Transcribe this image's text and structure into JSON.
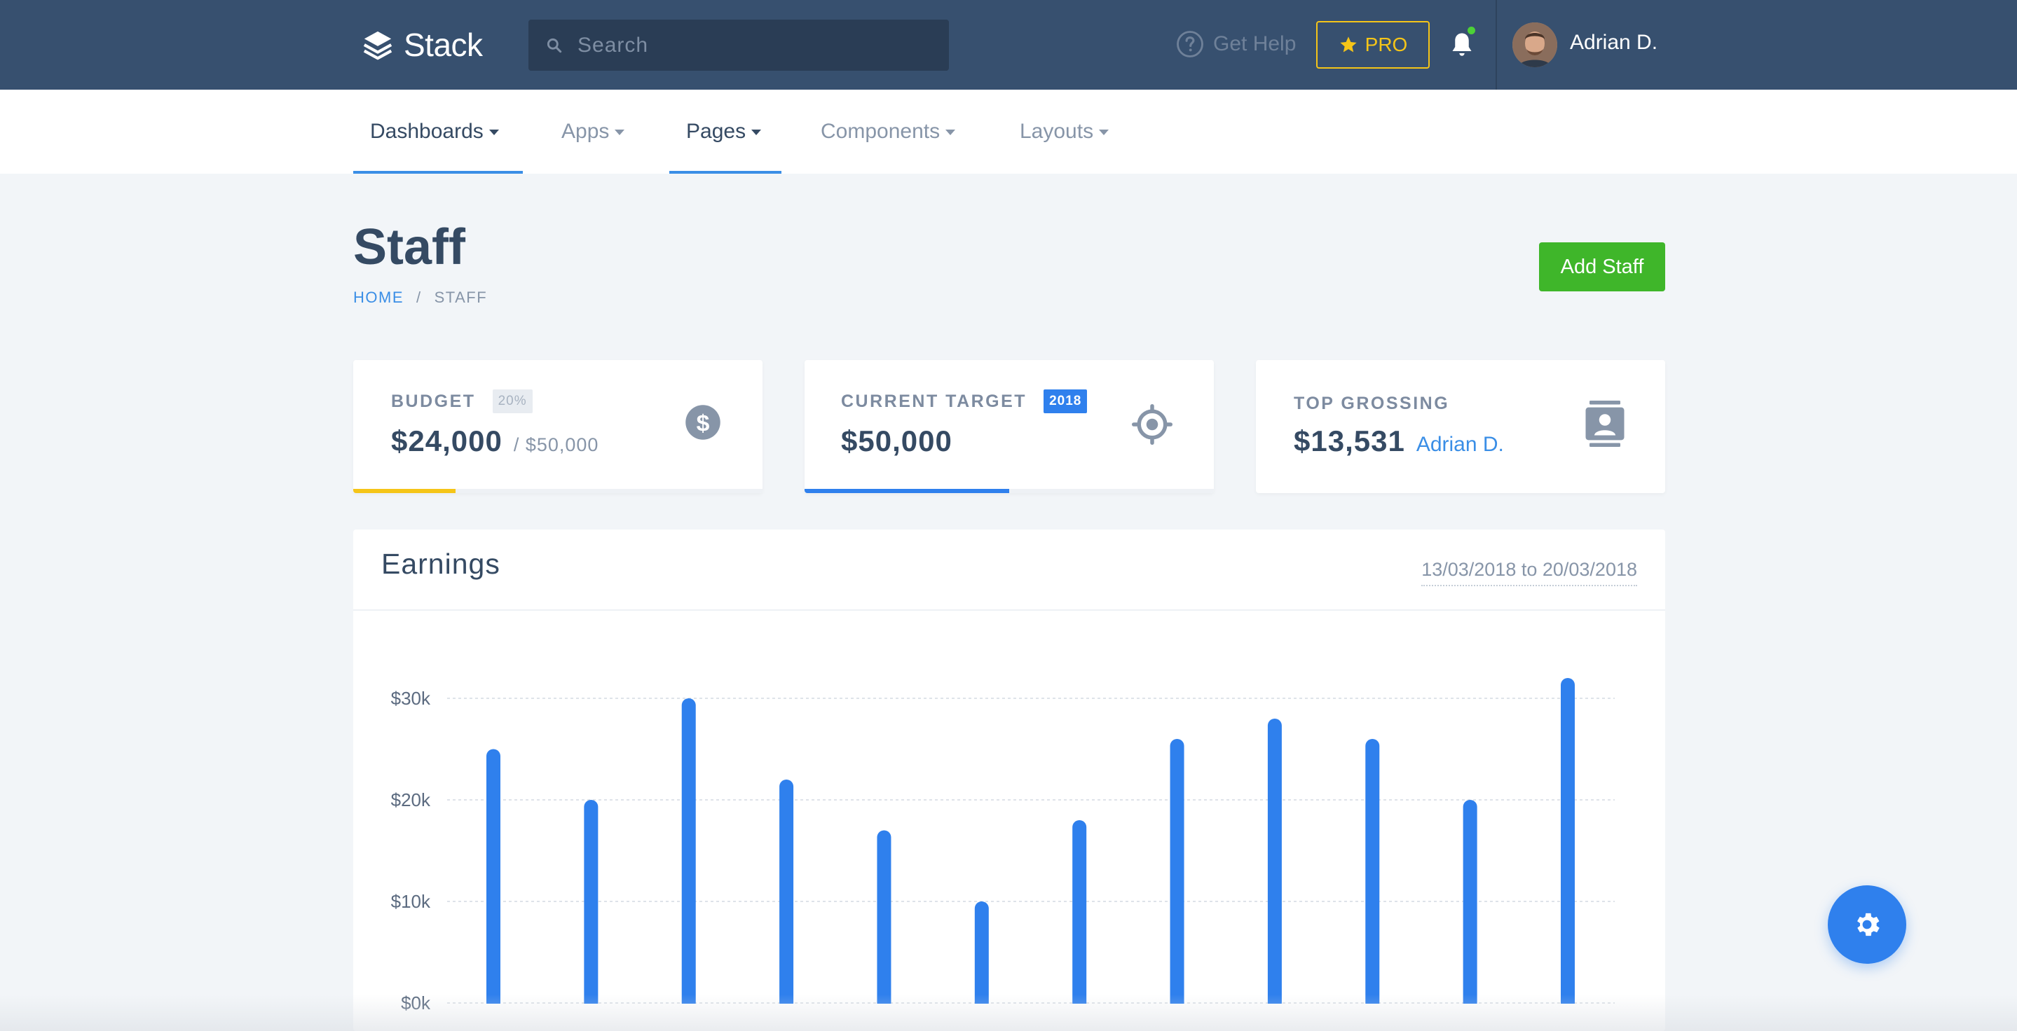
{
  "header": {
    "brand": "Stack",
    "search_placeholder": "Search",
    "help_label": "Get Help",
    "pro_label": "PRO",
    "user_name": "Adrian D."
  },
  "nav": {
    "items": [
      {
        "label": "Dashboards",
        "active": true
      },
      {
        "label": "Apps",
        "active": false
      },
      {
        "label": "Pages",
        "active": true
      },
      {
        "label": "Components",
        "active": false
      },
      {
        "label": "Layouts",
        "active": false
      }
    ]
  },
  "page": {
    "title": "Staff",
    "breadcrumb": {
      "home": "HOME",
      "separator": "/",
      "current": "STAFF"
    },
    "add_button": "Add Staff"
  },
  "cards": {
    "budget": {
      "label": "BUDGET",
      "badge": "20%",
      "value": "$24,000",
      "sub": "/ $50,000",
      "progress": 0.25,
      "progress_color": "#f5c518"
    },
    "target": {
      "label": "CURRENT TARGET",
      "badge": "2018",
      "value": "$50,000",
      "progress": 0.5,
      "progress_color": "#2f80ed"
    },
    "top": {
      "label": "TOP GROSSING",
      "value": "$13,531",
      "name": "Adrian D."
    }
  },
  "earnings": {
    "title": "Earnings",
    "range": "13/03/2018 to 20/03/2018"
  },
  "colors": {
    "topbar": "#37506f",
    "accent": "#2f80ed",
    "success": "#3fb62a",
    "warning": "#f5c518"
  },
  "chart_data": {
    "type": "bar",
    "title": "Earnings",
    "ylim": [
      0,
      30000
    ],
    "yticks": [
      0,
      10000,
      20000,
      30000
    ],
    "ytick_labels": [
      "$0k",
      "$10k",
      "$20k",
      "$30k"
    ],
    "grid": true,
    "values": [
      25000,
      20000,
      30000,
      22000,
      17000,
      10000,
      18000,
      26000,
      28000,
      26000,
      20000,
      32000
    ]
  }
}
